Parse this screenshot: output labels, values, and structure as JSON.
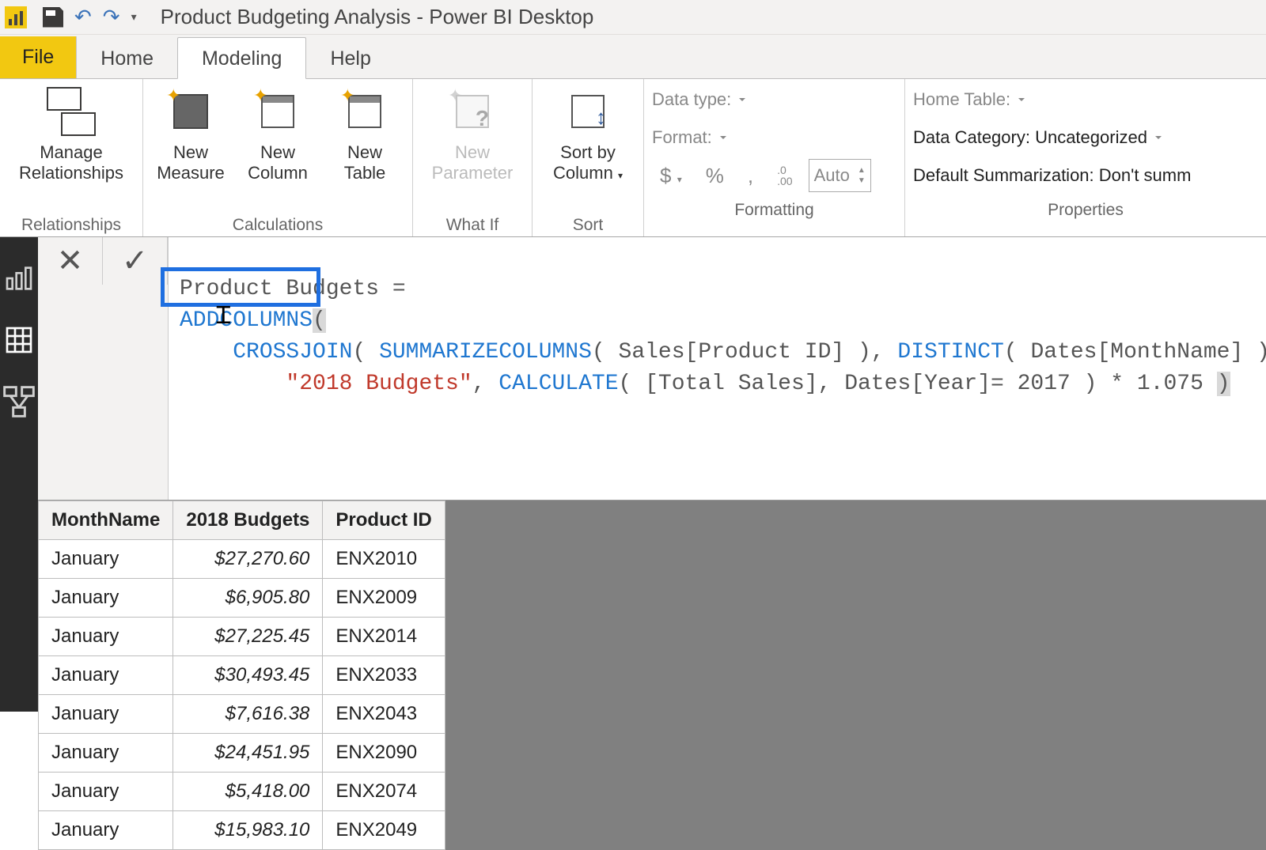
{
  "titlebar": {
    "app_title": "Product Budgeting Analysis - Power BI Desktop"
  },
  "ribbon_tabs": {
    "file": "File",
    "home": "Home",
    "modeling": "Modeling",
    "help": "Help"
  },
  "ribbon": {
    "relationships": {
      "manage": "Manage\nRelationships",
      "group": "Relationships"
    },
    "calculations": {
      "new_measure": "New\nMeasure",
      "new_column": "New\nColumn",
      "new_table": "New\nTable",
      "group": "Calculations"
    },
    "whatif": {
      "new_parameter": "New\nParameter",
      "group": "What If"
    },
    "sort": {
      "sort_by_column": "Sort by\nColumn",
      "group": "Sort"
    },
    "formatting": {
      "data_type": "Data type:",
      "format": "Format:",
      "currency": "$",
      "percent": "%",
      "comma": ",",
      "decimals": ".0\n.00",
      "auto": "Auto",
      "group": "Formatting"
    },
    "properties": {
      "home_table": "Home Table:",
      "data_category": "Data Category: Uncategorized",
      "default_summarization": "Default Summarization: Don't summ",
      "group": "Properties"
    }
  },
  "formula": {
    "line1_lead": "Product Budgets = ",
    "addcolumns": "ADDCOLUMNS",
    "paren_open": "(",
    "crossjoin": "CROSSJOIN",
    "summarizecolumns": "SUMMARIZECOLUMNS",
    "sales_product_id": " Sales[Product ID] ",
    "distinct": "DISTINCT",
    "dates_monthname": " Dates[MonthName] ",
    "budget_str": "\"2018 Budgets\"",
    "calculate": "CALCULATE",
    "total_sales": " [Total Sales]",
    "dates_year": " Dates[Year]= 2017 ",
    "mult": " * 1.075 "
  },
  "table": {
    "columns": [
      "MonthName",
      "2018 Budgets",
      "Product ID"
    ],
    "rows": [
      {
        "month": "January",
        "budget": "$27,270.60",
        "product": "ENX2010"
      },
      {
        "month": "January",
        "budget": "$6,905.80",
        "product": "ENX2009"
      },
      {
        "month": "January",
        "budget": "$27,225.45",
        "product": "ENX2014"
      },
      {
        "month": "January",
        "budget": "$30,493.45",
        "product": "ENX2033"
      },
      {
        "month": "January",
        "budget": "$7,616.38",
        "product": "ENX2043"
      },
      {
        "month": "January",
        "budget": "$24,451.95",
        "product": "ENX2090"
      },
      {
        "month": "January",
        "budget": "$5,418.00",
        "product": "ENX2074"
      },
      {
        "month": "January",
        "budget": "$15,983.10",
        "product": "ENX2049"
      }
    ]
  }
}
